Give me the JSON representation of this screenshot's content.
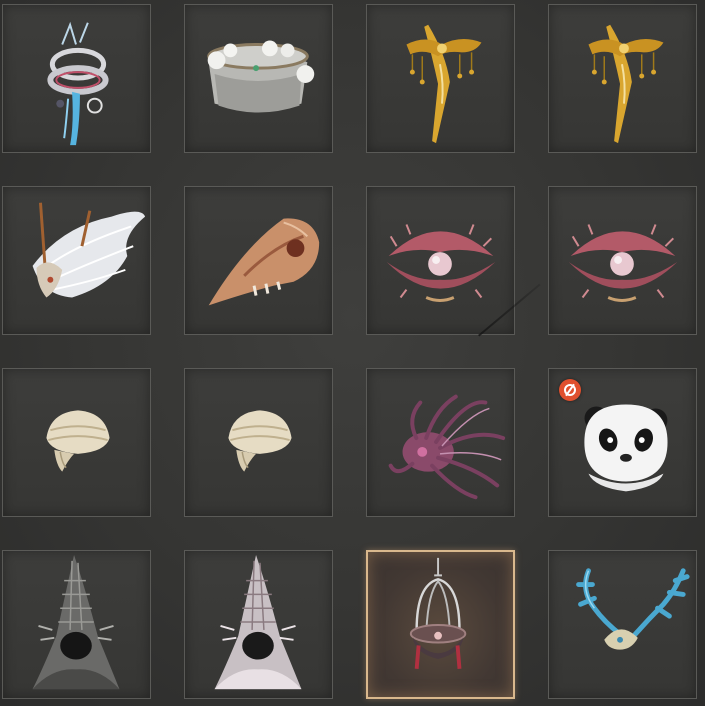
{
  "inventory": {
    "slots": [
      {
        "item": "ornate-silver-crown-with-blue-feather",
        "icon": "silver-crown-icon"
      },
      {
        "item": "white-flower-veiled-crown",
        "icon": "veil-crown-icon"
      },
      {
        "item": "golden-hairpin-with-dangling-ornaments",
        "icon": "golden-hairpin-icon"
      },
      {
        "item": "golden-hairpin-with-dangling-ornaments",
        "icon": "golden-hairpin-icon"
      },
      {
        "item": "white-fur-horned-headdress",
        "icon": "fur-headdress-icon"
      },
      {
        "item": "bird-skull-mask",
        "icon": "bird-skull-icon"
      },
      {
        "item": "pink-clam-shell-pearl-hat",
        "icon": "clam-shell-icon"
      },
      {
        "item": "pink-clam-shell-pearl-hat",
        "icon": "clam-shell-icon"
      },
      {
        "item": "white-cloth-turban",
        "icon": "turban-icon"
      },
      {
        "item": "white-cloth-turban",
        "icon": "turban-icon"
      },
      {
        "item": "purple-tentacle-headpiece",
        "icon": "tentacle-icon"
      },
      {
        "item": "panda-hood",
        "icon": "panda-icon",
        "badge": "new-badge-icon"
      },
      {
        "item": "dark-grey-pointed-fur-hood",
        "icon": "pointed-hood-icon"
      },
      {
        "item": "white-pointed-fur-hood",
        "icon": "pointed-hood-icon"
      },
      {
        "item": "caged-lantern-helm",
        "icon": "cage-helm-icon",
        "selected": true
      },
      {
        "item": "blue-antler-headdress",
        "icon": "antler-icon"
      }
    ],
    "colors": {
      "background": "#353533",
      "slot_border": "#5a5a57",
      "selected_border": "#d9b88d",
      "badge": "#e0502e"
    }
  }
}
